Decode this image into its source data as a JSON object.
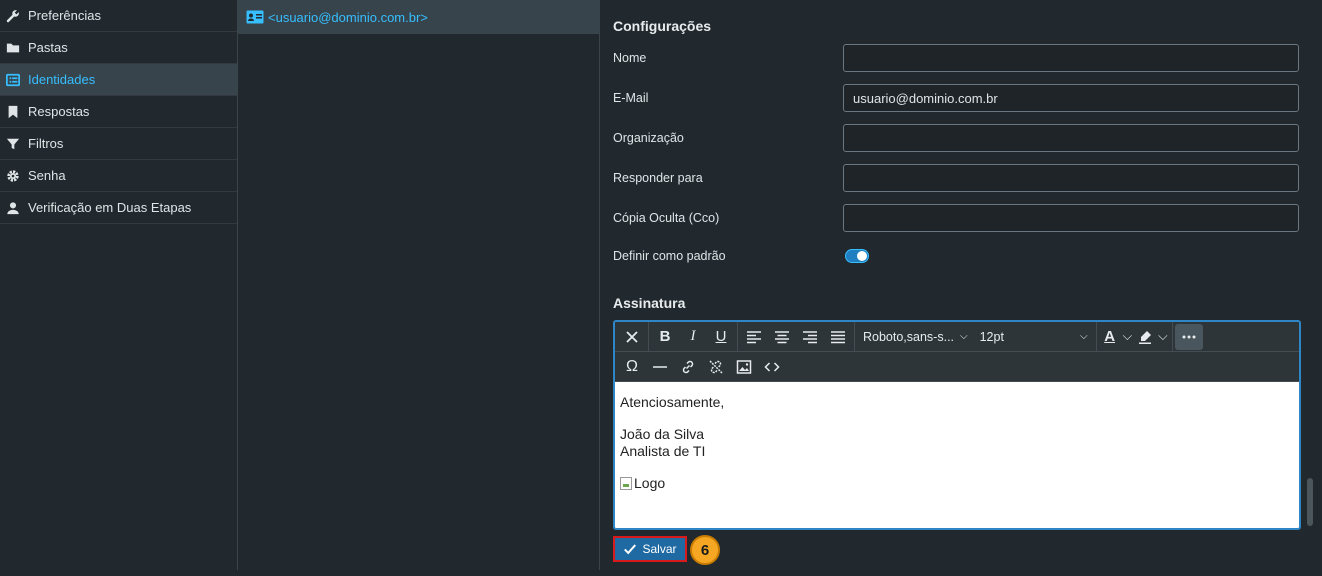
{
  "sidebar": {
    "items": [
      {
        "label": "Preferências",
        "icon": "wrench-icon"
      },
      {
        "label": "Pastas",
        "icon": "folder-icon"
      },
      {
        "label": "Identidades",
        "icon": "id-list-icon",
        "active": true
      },
      {
        "label": "Respostas",
        "icon": "bookmark-icon"
      },
      {
        "label": "Filtros",
        "icon": "filter-icon"
      },
      {
        "label": "Senha",
        "icon": "gear-icon"
      },
      {
        "label": "Verificação em Duas Etapas",
        "icon": "user-icon"
      }
    ]
  },
  "identities": {
    "items": [
      {
        "label": "<usuario@dominio.com.br>",
        "icon": "id-card-icon"
      }
    ]
  },
  "form": {
    "section_title": "Configurações",
    "fields": {
      "nome": {
        "label": "Nome",
        "value": ""
      },
      "email": {
        "label": "E-Mail",
        "value": "usuario@dominio.com.br"
      },
      "organizacao": {
        "label": "Organização",
        "value": ""
      },
      "responder": {
        "label": "Responder para",
        "value": ""
      },
      "cco": {
        "label": "Cópia Oculta (Cco)",
        "value": ""
      }
    },
    "default_toggle": {
      "label": "Definir como padrão",
      "checked": true
    }
  },
  "signature": {
    "section_title": "Assinatura",
    "toolbar": {
      "font_family": "Roboto,sans-s...",
      "font_size": "12pt"
    },
    "body": {
      "line1": "Atenciosamente,",
      "line2": "João da Silva",
      "line3": "Analista de TI",
      "logo_alt": "Logo"
    }
  },
  "footer": {
    "save_label": "Salvar",
    "step_number": "6"
  },
  "colors": {
    "accent": "#37beff",
    "save_bg": "#1f6aa3",
    "highlight_border": "#d91a1a",
    "badge": "#f5a623"
  }
}
